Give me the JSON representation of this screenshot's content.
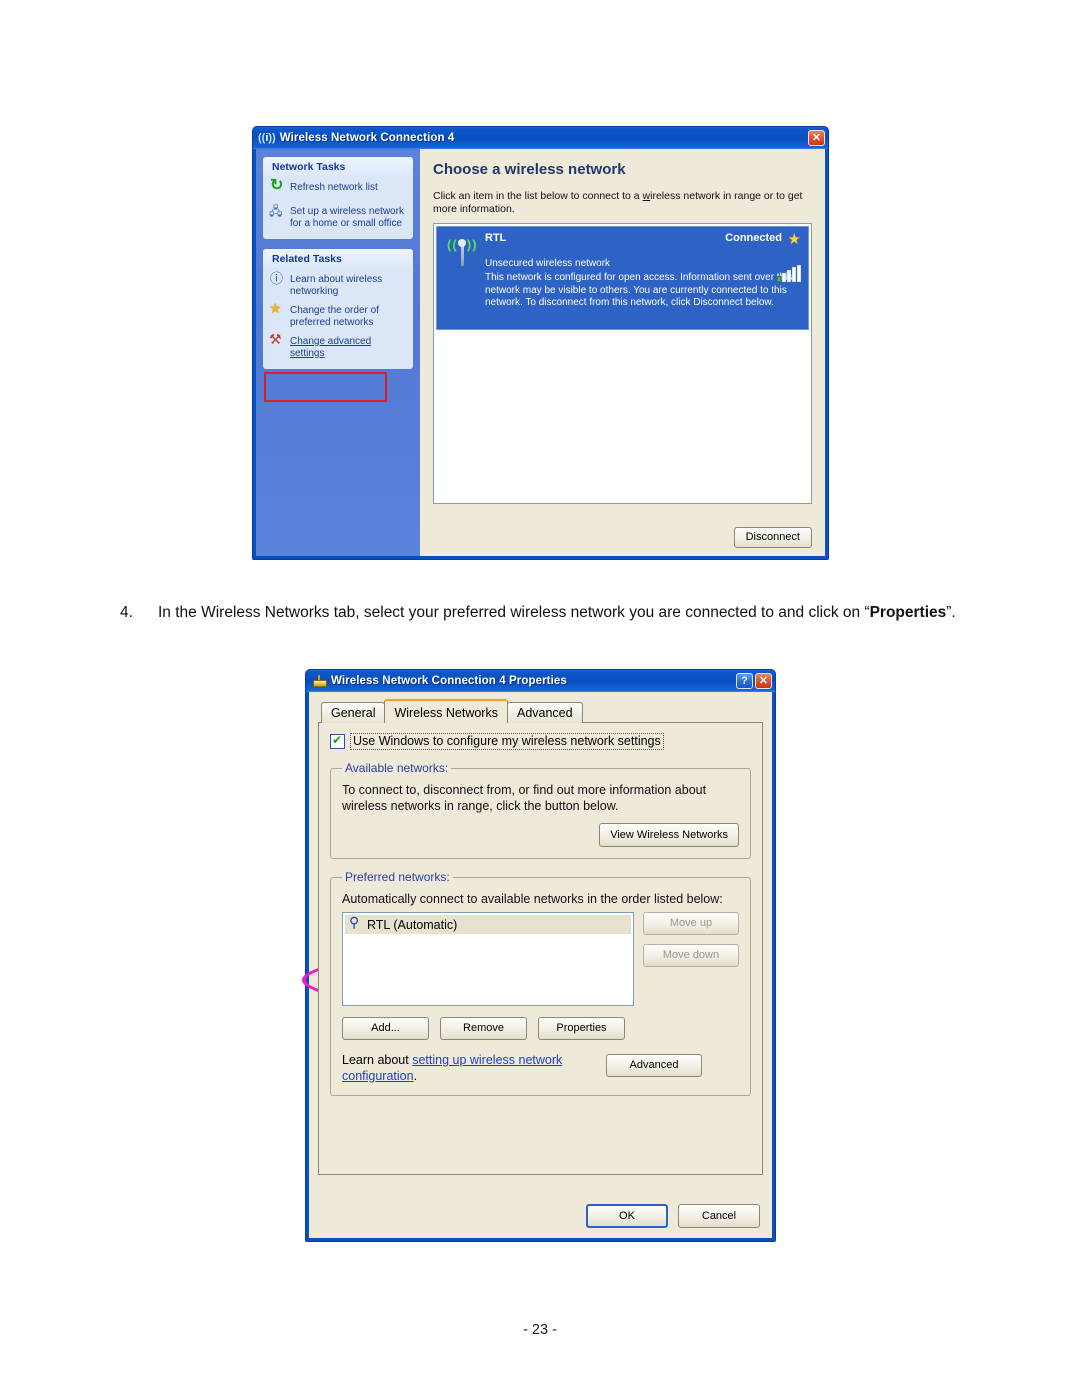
{
  "dialog1": {
    "title": "Wireless Network Connection 4",
    "title_icon": "wireless-signal-icon",
    "close_label": "✕",
    "sidebar": {
      "panels": [
        {
          "heading": "Network Tasks",
          "items": [
            {
              "icon": "refresh-icon",
              "label": "Refresh network list",
              "link": false
            },
            {
              "icon": "setup-wireless-icon",
              "label": "Set up a wireless network for a home or small office",
              "link": false
            }
          ]
        },
        {
          "heading": "Related Tasks",
          "items": [
            {
              "icon": "info-icon",
              "label": "Learn about wireless networking",
              "link": false
            },
            {
              "icon": "star-icon",
              "label": "Change the order of preferred networks",
              "link": false
            },
            {
              "icon": "advanced-settings-icon",
              "label": "Change advanced settings",
              "link": true
            }
          ]
        }
      ]
    },
    "main": {
      "heading": "Choose a wireless network",
      "instruction_pre": "Click an item in the list below to connect to a ",
      "instruction_underline": "w",
      "instruction_post": "ireless network in range or to get more information.",
      "network": {
        "ssid": "RTL",
        "status": "Connected",
        "security": "Unsecured wireless network",
        "description": "This network is configured for open access. Information sent over this network may be visible to others. You are currently connected to this network. To disconnect from this network, click Disconnect below.",
        "signal_bars": 5,
        "signal_filled": 1,
        "star_icon": "favorite-star-icon",
        "wifi_icon": "wireless-broadcast-icon"
      },
      "disconnect_label": "Disconnect"
    },
    "highlight_box_color": "#e01d1d"
  },
  "step": {
    "number": "4.",
    "text_part1": "In the Wireless Networks tab, select your preferred wireless network you are connected to and click on “",
    "text_bold": "Properties",
    "text_part2": "”."
  },
  "dialog2": {
    "title": "Wireless Network Connection 4 Properties",
    "title_icon": "network-adapter-icon",
    "help_label": "?",
    "close_label": "✕",
    "tabs": [
      {
        "label": "General",
        "active": false
      },
      {
        "label": "Wireless Networks",
        "active": true
      },
      {
        "label": "Advanced",
        "active": false
      }
    ],
    "use_windows_checkbox": {
      "checked": true,
      "label": "Use Windows to configure my wireless network settings"
    },
    "available_networks": {
      "legend": "Available networks:",
      "text": "To connect to, disconnect from, or find out more information about wireless networks in range, click the button below.",
      "button": "View Wireless Networks"
    },
    "preferred_networks": {
      "legend": "Preferred networks:",
      "text": "Automatically connect to available networks in the order listed below:",
      "items": [
        {
          "icon": "network-key-icon",
          "label": "RTL (Automatic)",
          "selected": true
        }
      ],
      "move_up": "Move up",
      "move_down": "Move down",
      "add": "Add...",
      "remove": "Remove",
      "properties": "Properties"
    },
    "learn": {
      "prefix": "Learn about ",
      "link": "setting up wireless network configuration",
      "suffix": "."
    },
    "advanced_button": "Advanced",
    "footer": {
      "ok": "OK",
      "cancel": "Cancel"
    }
  },
  "annotations": {
    "ellipse_color": "#ee19c0",
    "targets": [
      "wireless-networks-tab",
      "preferred-network-rtl",
      "properties-button"
    ]
  },
  "page_footer": "- 23 -"
}
